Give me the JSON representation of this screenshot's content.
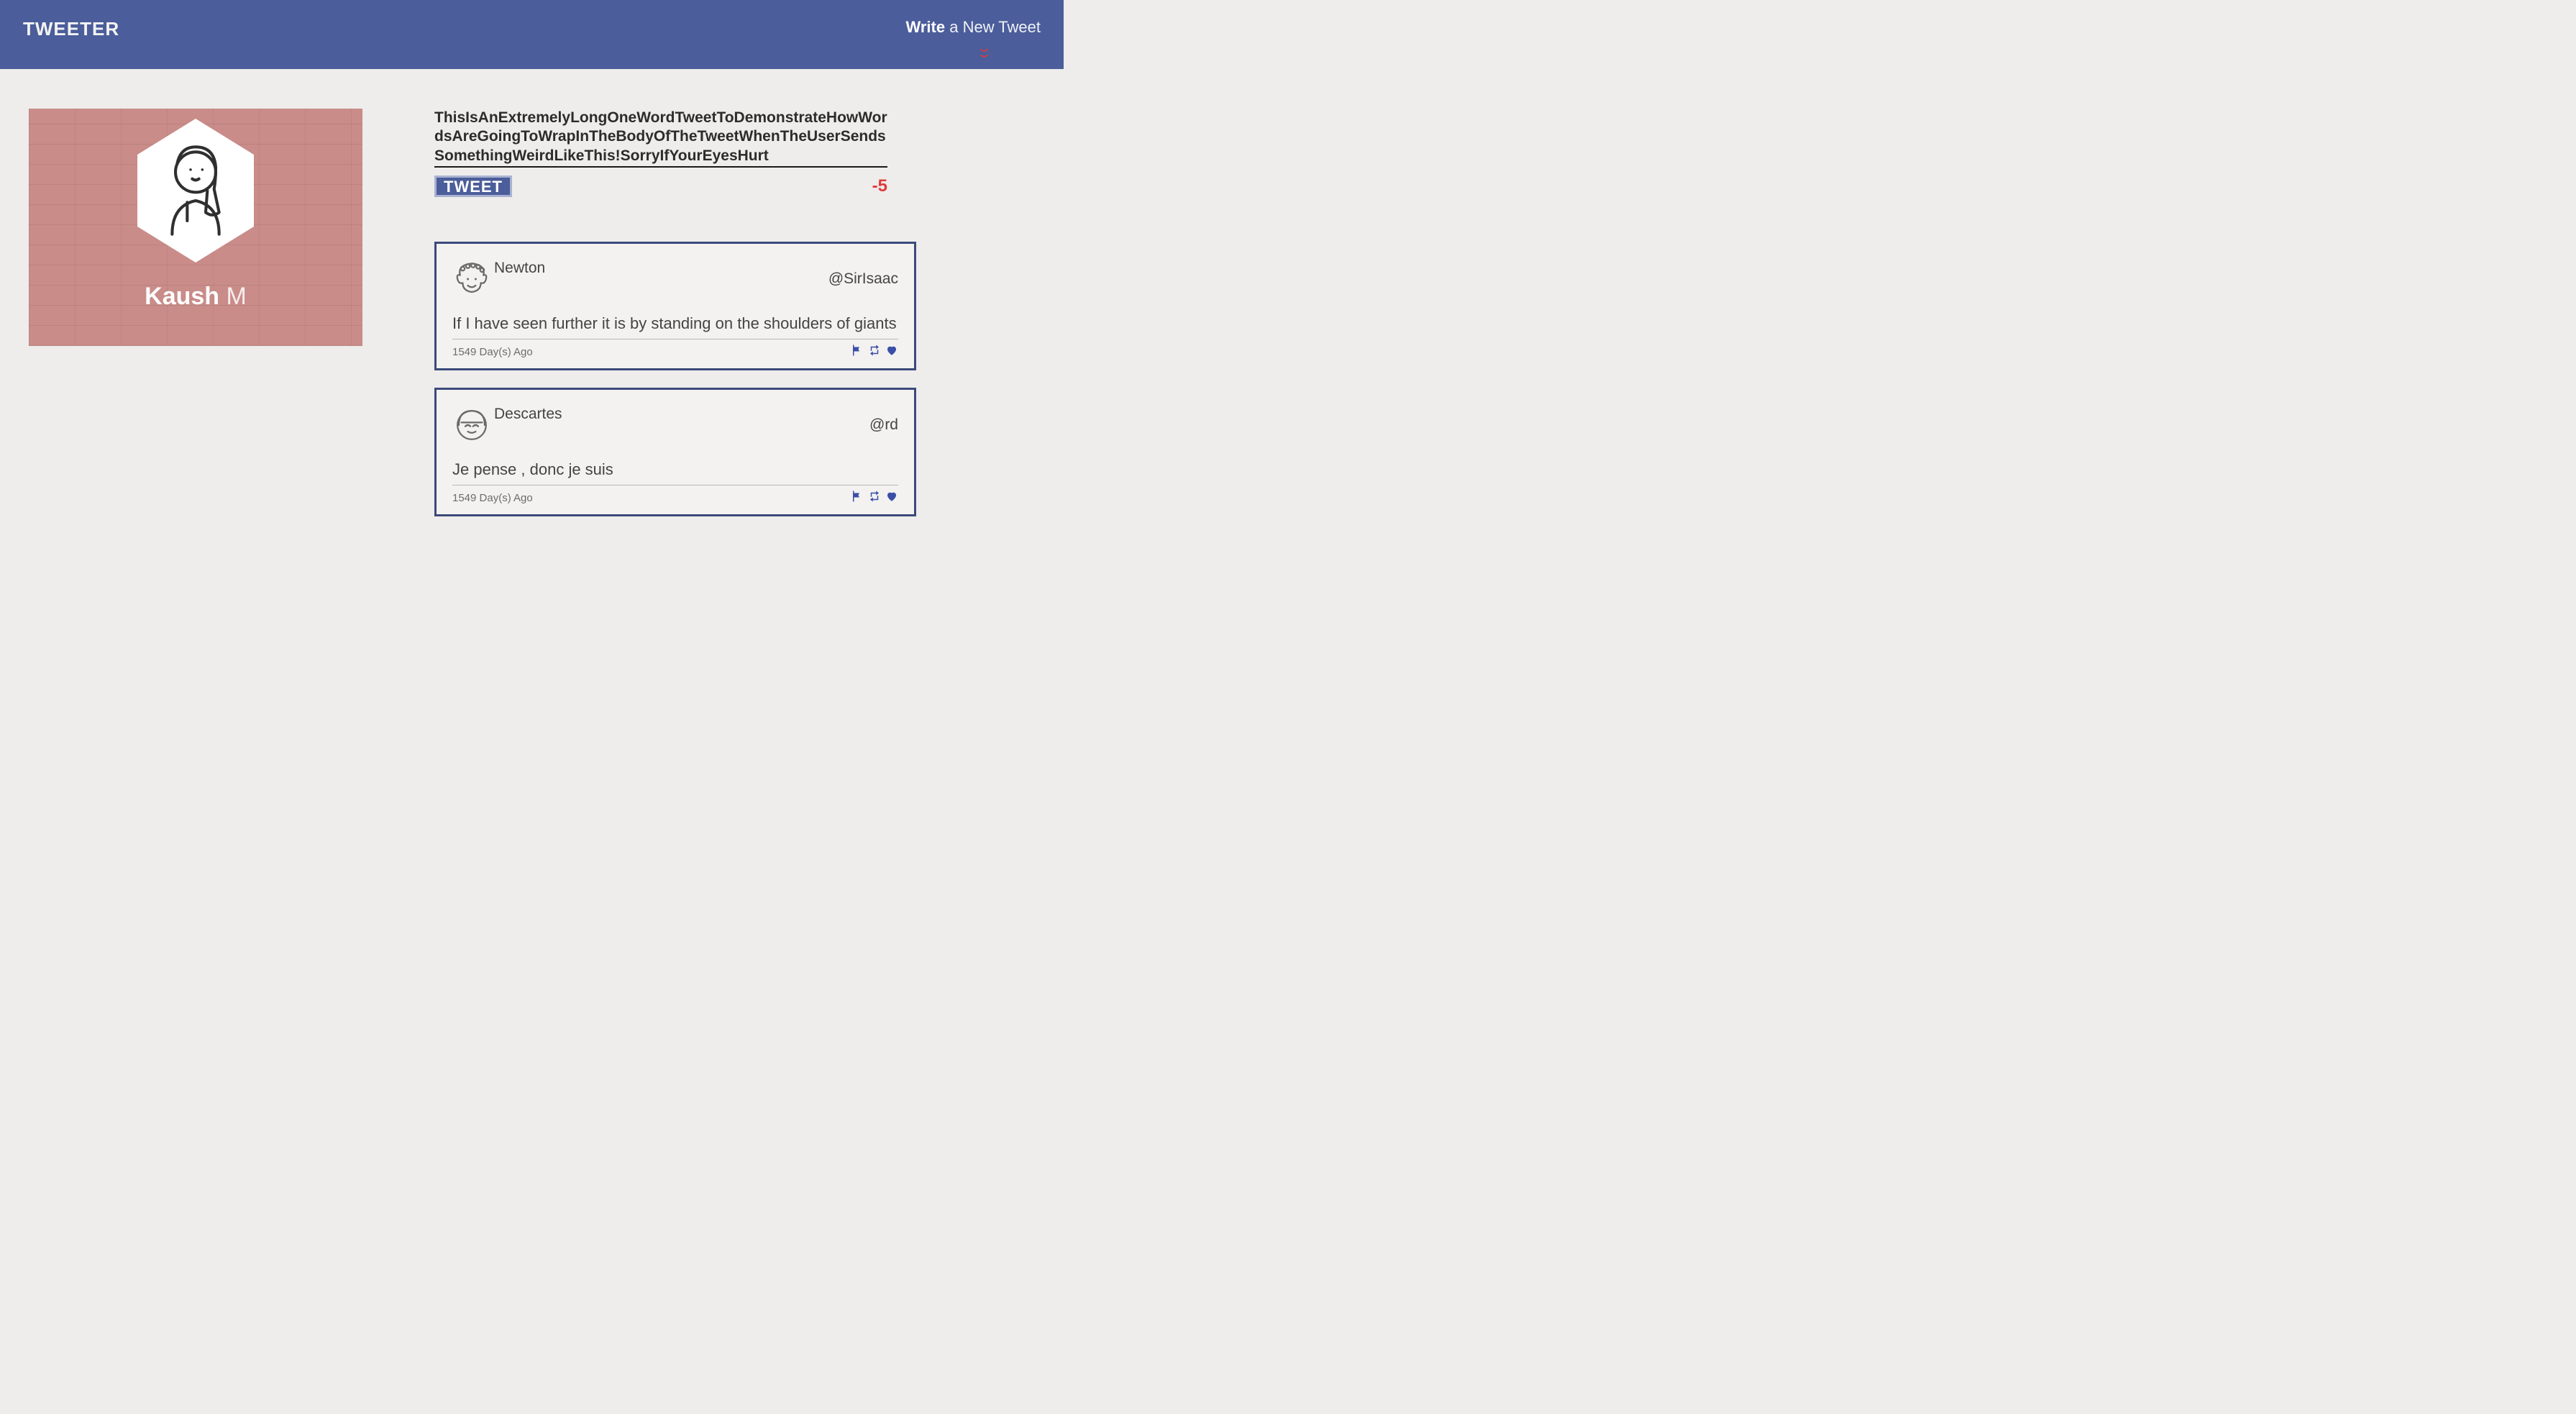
{
  "nav": {
    "logo": "TWEETER",
    "compose_prompt_strong": "Write",
    "compose_prompt_rest": " a New Tweet"
  },
  "profile": {
    "first_name": "Kaush",
    "last_name": "M",
    "avatar": "female-avatar"
  },
  "compose": {
    "text": "ThisIsAnExtremelyLongOneWordTweetToDemonstrateHowWordsAreGoingToWrapInTheBodyOfTheTweetWhenTheUserSendsSomethingWeirdLikeThis!SorryIfYourEyesHurt",
    "button_label": "TWEET",
    "char_counter": "-5"
  },
  "feed": [
    {
      "avatar": "newton-avatar",
      "display_name": "Newton",
      "handle": "@SirIsaac",
      "body": "If I have seen further it is by standing on the shoulders of giants",
      "age": "1549 Day(s) Ago"
    },
    {
      "avatar": "descartes-avatar",
      "display_name": "Descartes",
      "handle": "@rd",
      "body": "Je pense , donc je suis",
      "age": "1549 Day(s) Ago"
    }
  ]
}
